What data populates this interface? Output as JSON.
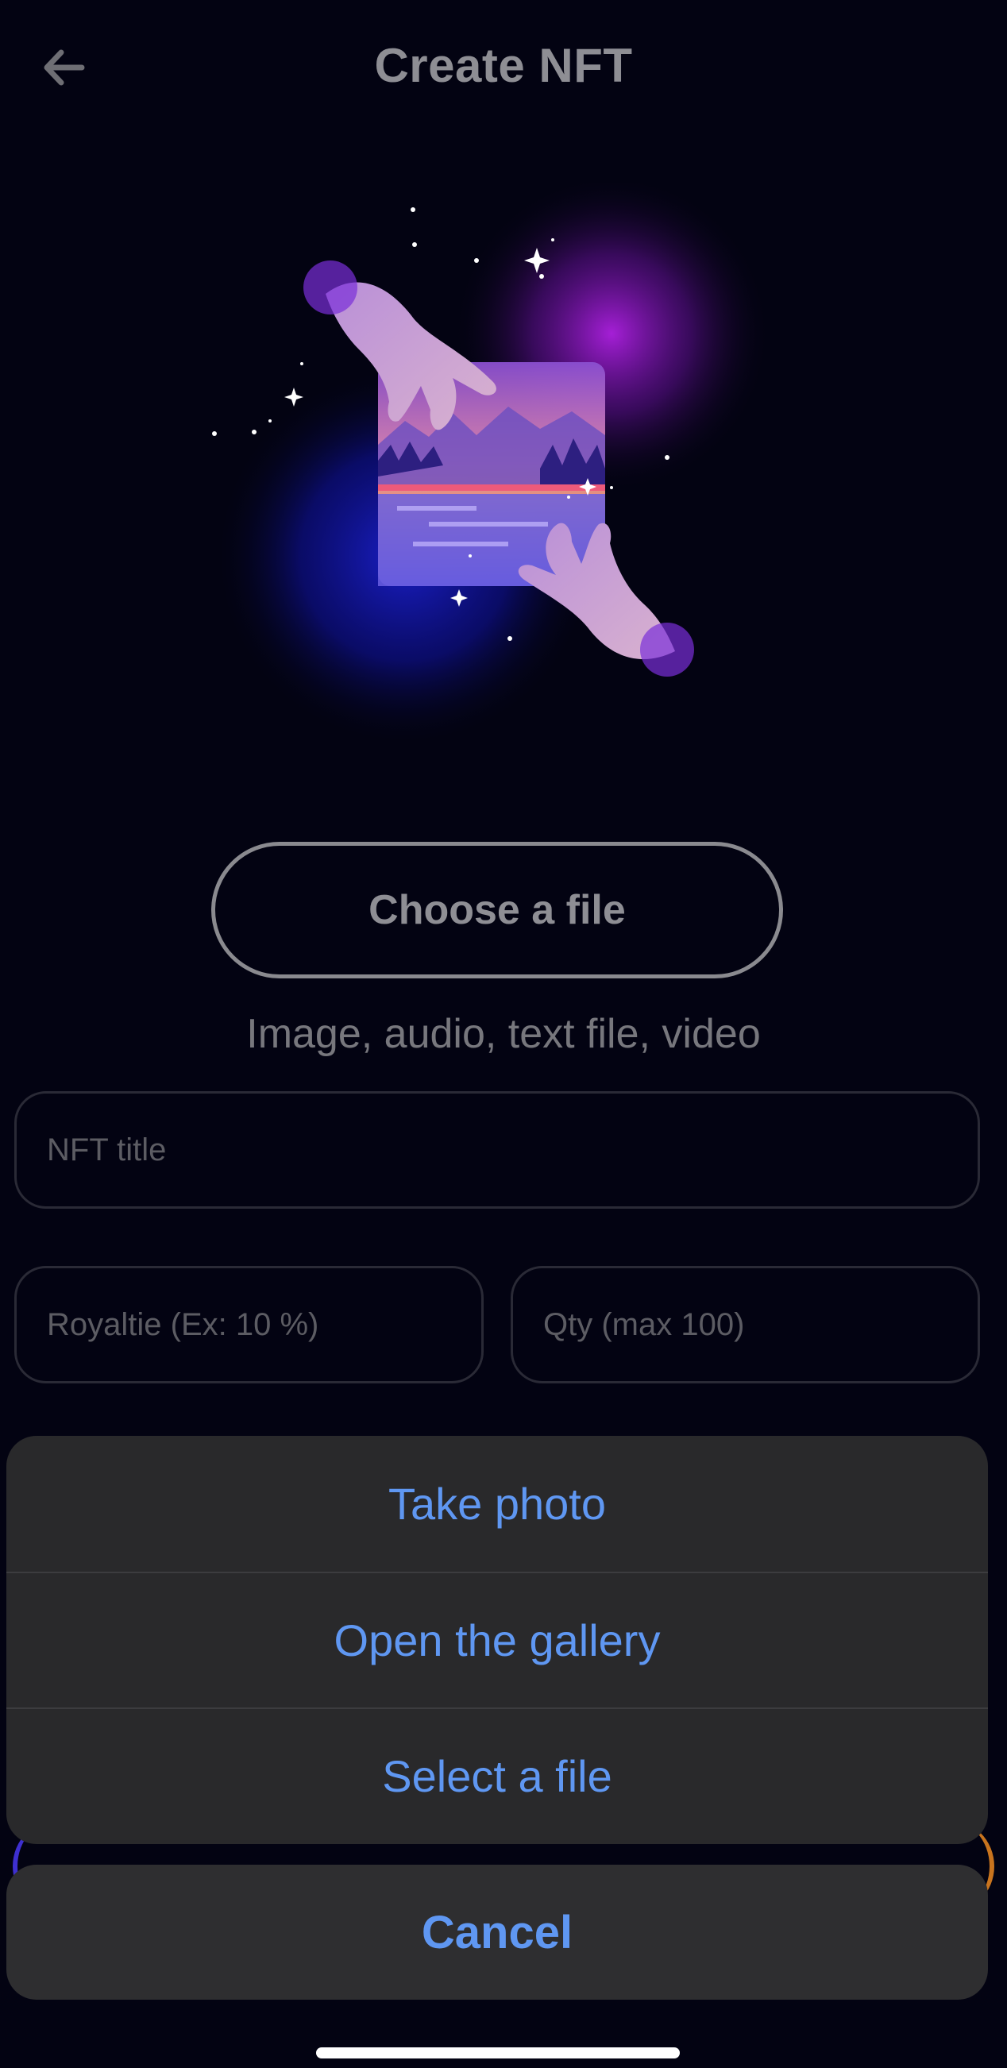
{
  "header": {
    "title": "Create NFT",
    "back_icon": "arrow-left-icon"
  },
  "illustration": {
    "icon": "nft-hands-artwork-illustration"
  },
  "upload": {
    "choose_label": "Choose a file",
    "hint": "Image, audio,  text file, video"
  },
  "form": {
    "title_placeholder": "NFT title",
    "royalty_placeholder": "Royaltie (Ex: 10 %)",
    "qty_placeholder": "Qty (max 100)"
  },
  "action_sheet": {
    "items": [
      {
        "label": "Take photo"
      },
      {
        "label": "Open the gallery"
      },
      {
        "label": "Select a file"
      }
    ],
    "cancel_label": "Cancel"
  },
  "colors": {
    "background": "#030312",
    "action_text": "#5f97f2",
    "sheet_bg": "#29292b"
  }
}
